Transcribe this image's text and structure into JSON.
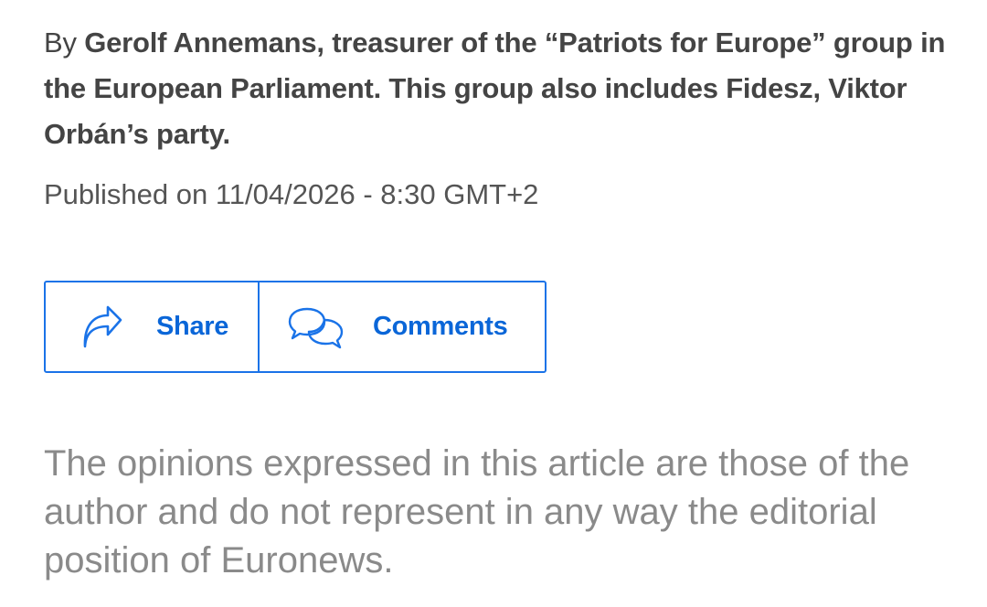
{
  "byline": {
    "prefix": "By ",
    "author": "Gerolf Annemans, treasurer of the “Patriots for Europe” group in the European Parliament. This group also includes Fidesz, Viktor Orbán’s party."
  },
  "published": "Published on 11/04/2026 - 8:30 GMT+2",
  "actions": {
    "share_label": "Share",
    "share_icon": "share-arrow-icon",
    "comments_label": "Comments",
    "comments_icon": "speech-bubbles-icon",
    "accent_color": "#1a73e8"
  },
  "disclaimer": "The opinions expressed in this article are those of the author and do not represent in any way the editorial position of Euronews."
}
